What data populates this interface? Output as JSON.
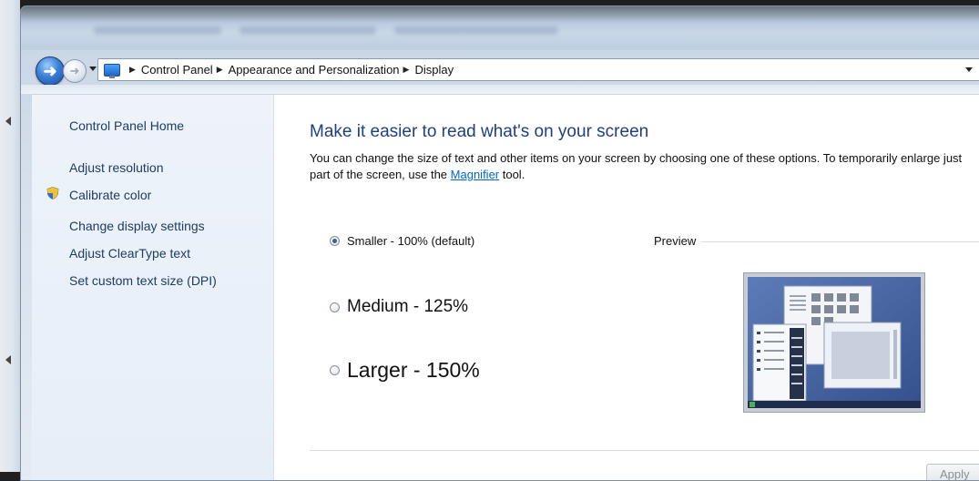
{
  "address_bar": {
    "crumbs": [
      "Control Panel",
      "Appearance and Personalization",
      "Display"
    ]
  },
  "sidebar": {
    "home_label": "Control Panel Home",
    "items": [
      {
        "label": "Adjust resolution"
      },
      {
        "label": "Calibrate color",
        "icon": "shield-icon"
      },
      {
        "label": "Change display settings"
      },
      {
        "label": "Adjust ClearType text"
      },
      {
        "label": "Set custom text size (DPI)"
      }
    ]
  },
  "main": {
    "heading": "Make it easier to read what's on your screen",
    "desc_before": "You can change the size of text and other items on your screen by choosing one of these options. To temporarily enlarge just part of the screen, use the ",
    "desc_link": "Magnifier",
    "desc_after": " tool.",
    "options": [
      {
        "label": "Smaller - 100% (default)",
        "checked": true
      },
      {
        "label": "Medium - 125%",
        "checked": false
      },
      {
        "label": "Larger - 150%",
        "checked": false
      }
    ],
    "preview_label": "Preview",
    "apply_label": "Apply"
  },
  "colors": {
    "heading": "#1e3f82",
    "link": "#0066cc",
    "sidebar_bg": "#eef3fa",
    "preview_desktop": "#3f5f9f"
  }
}
